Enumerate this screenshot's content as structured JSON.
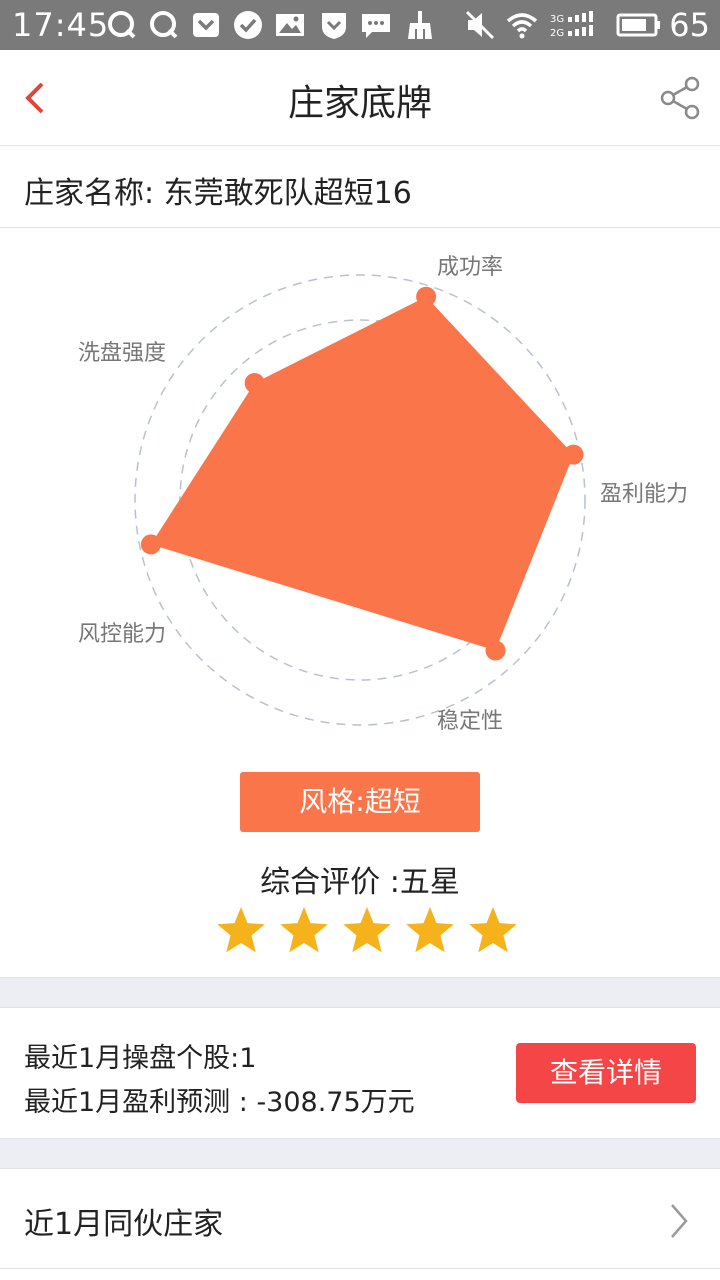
{
  "status_bar": {
    "time": "17:45",
    "battery": "65",
    "icons": [
      "q-icon",
      "q-icon",
      "pocket-icon",
      "check-icon",
      "image-icon",
      "shield-icon",
      "message-icon",
      "broom-icon",
      "mute-icon",
      "wifi-icon",
      "signal-icon",
      "battery-icon"
    ]
  },
  "header": {
    "title": "庄家底牌",
    "back_icon": "chevron-left-icon",
    "share_icon": "share-icon"
  },
  "dealer": {
    "name_line": "庄家名称: 东莞敢死队超短16"
  },
  "radar": {
    "axes": [
      "成功率",
      "盈利能力",
      "稳定性",
      "风控能力",
      "洗盘强度"
    ],
    "values": [
      0.95,
      0.97,
      0.9,
      0.95,
      0.7
    ],
    "fill_color": "#fa764a"
  },
  "style_tag": "风格:超短",
  "rating": {
    "text": "综合评价 :五星",
    "stars": 5,
    "star_color": "#f5b21a"
  },
  "stats": {
    "stocks_line": "最近1月操盘个股:1",
    "profit_line": "最近1月盈利预测 : -308.75万元",
    "detail_button": "查看详情"
  },
  "partners": {
    "label": "近1月同伙庄家"
  },
  "colors": {
    "accent": "#fa764a",
    "button_red": "#f44646",
    "back_red": "#e2463a"
  }
}
